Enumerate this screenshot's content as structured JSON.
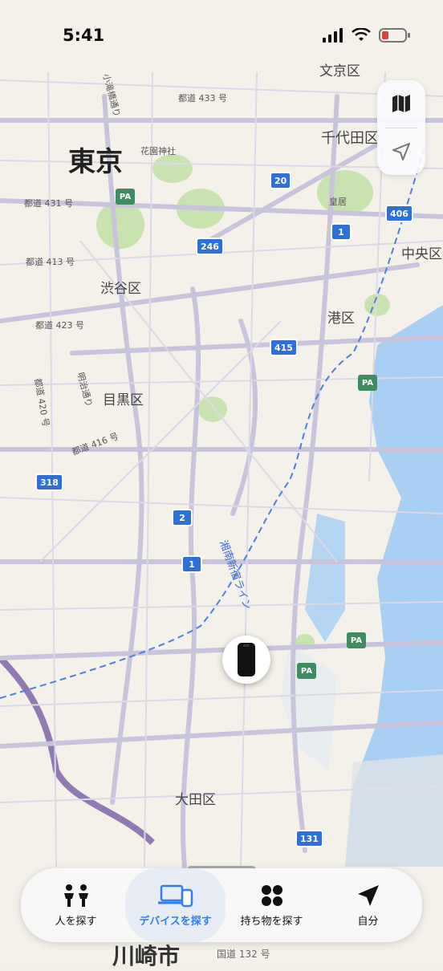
{
  "status_bar": {
    "time": "5:41"
  },
  "map": {
    "districts": [
      "文京区",
      "千代田区",
      "中央区",
      "渋谷区",
      "港区",
      "目黒区",
      "大田区"
    ],
    "city_label": "東京",
    "bottom_city_label": "川崎市",
    "landmarks": [
      "花園神社",
      "皇居"
    ],
    "roads": [
      "都道 433 号",
      "都道 431 号",
      "都道 413 号",
      "都道 423 号",
      "都道 420 号",
      "都道 416 号",
      "国道 132 号",
      "小滝橋通り",
      "明治通り",
      "湘南新宿ライン"
    ],
    "route_shields": [
      "20",
      "406",
      "1",
      "246",
      "415",
      "318",
      "2",
      "1",
      "131"
    ],
    "pa_label": "PA"
  },
  "map_controls": {
    "map_icon": "map-icon",
    "location_icon": "location-arrow-icon"
  },
  "device_pin": {
    "icon": "iphone-icon"
  },
  "tabs": [
    {
      "label": "人を探す",
      "icon": "people-icon",
      "active": false
    },
    {
      "label": "デバイスを探す",
      "icon": "devices-icon",
      "active": true
    },
    {
      "label": "持ち物を探す",
      "icon": "items-icon",
      "active": false
    },
    {
      "label": "自分",
      "icon": "me-arrow-icon",
      "active": false
    }
  ],
  "colors": {
    "accent": "#2f7ff0",
    "water": "#a9cff2",
    "park": "#c9e3b0",
    "shield": "#2e6fd8"
  }
}
